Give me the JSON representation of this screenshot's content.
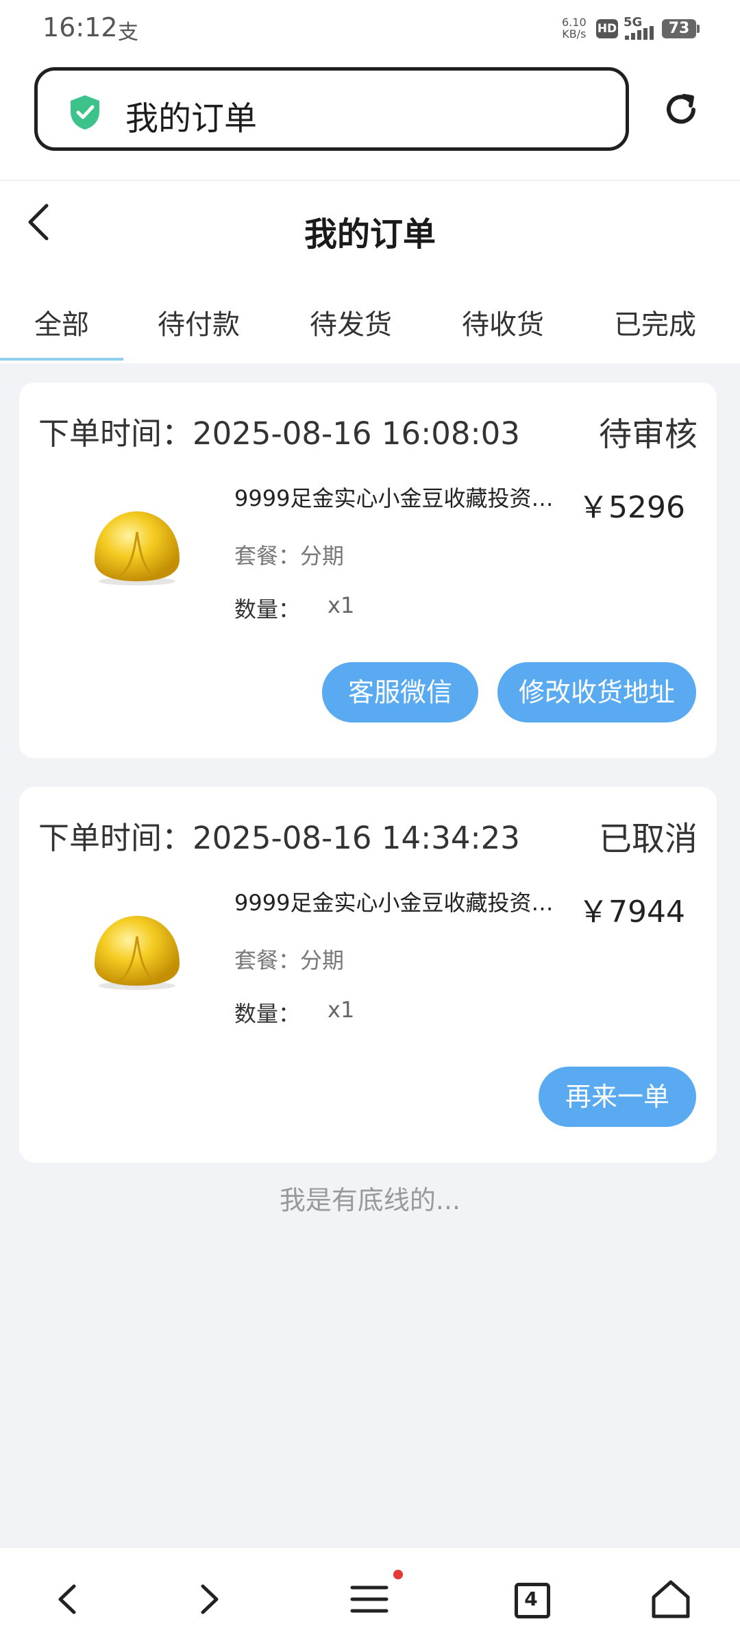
{
  "status_bar": {
    "time": "16:12",
    "app_icon": "支",
    "net_speed_value": "6.10",
    "net_speed_unit": "KB/s",
    "hd": "HD",
    "network": "5G",
    "battery": "73"
  },
  "browser": {
    "address_text": "我的订单",
    "secure_icon": "shield-check-icon",
    "reload_icon": "reload-icon"
  },
  "header": {
    "title": "我的订单",
    "back_icon": "chevron-left-icon"
  },
  "tabs": [
    {
      "label": "全部",
      "active": true
    },
    {
      "label": "待付款",
      "active": false
    },
    {
      "label": "待发货",
      "active": false
    },
    {
      "label": "待收货",
      "active": false
    },
    {
      "label": "已完成",
      "active": false
    }
  ],
  "orders": [
    {
      "time": "下单时间：2025-08-16 16:08:03",
      "status": "待审核",
      "product_name": "9999足金实心小金豆收藏投资…",
      "price": "￥5296",
      "package": "套餐：分期",
      "qty_label": "数量：",
      "qty": "x1",
      "buttons": [
        "客服微信",
        "修改收货地址"
      ]
    },
    {
      "time": "下单时间：2025-08-16 14:34:23",
      "status": "已取消",
      "product_name": "9999足金实心小金豆收藏投资…",
      "price": "￥7944",
      "package": "套餐：分期",
      "qty_label": "数量：",
      "qty": "x1",
      "buttons": [
        "再来一单"
      ]
    }
  ],
  "footer_note": "我是有底线的...",
  "bottom_nav": {
    "tab_count": "4"
  },
  "colors": {
    "accent_button": "#5aaaf2",
    "tab_underline": "#8fd0f0",
    "secure_green": "#3cc28a",
    "gold": "#f2c21a",
    "notification_dot": "#e53935"
  }
}
